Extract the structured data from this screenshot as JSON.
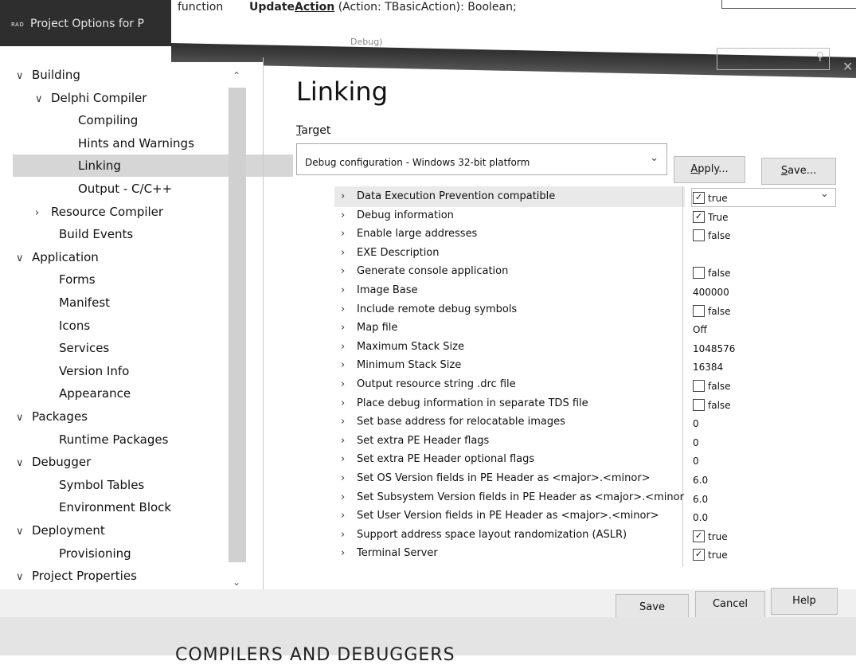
{
  "background_code": {
    "keyword": "function",
    "signature_prefix": "Update",
    "signature_underlined": "Action",
    "signature_rest": " (Action: TBasicAction): Boolean;",
    "fragment": "Debug)"
  },
  "window": {
    "app_icon_text": "RAD",
    "title": "Project Options for P"
  },
  "tree": {
    "items": [
      {
        "label": "Building",
        "expander": "v"
      },
      {
        "label": "Delphi Compiler",
        "expander": "v"
      },
      {
        "label": "Compiling",
        "expander": ""
      },
      {
        "label": "Hints and Warnings",
        "expander": ""
      },
      {
        "label": "Linking",
        "expander": "",
        "selected": true
      },
      {
        "label": "Output - C/C++",
        "expander": ""
      },
      {
        "label": "Resource Compiler",
        "expander": ">"
      },
      {
        "label": "Build Events",
        "expander": ""
      },
      {
        "label": "Application",
        "expander": "v"
      },
      {
        "label": "Forms",
        "expander": ""
      },
      {
        "label": "Manifest",
        "expander": ""
      },
      {
        "label": "Icons",
        "expander": ""
      },
      {
        "label": "Services",
        "expander": ""
      },
      {
        "label": "Version Info",
        "expander": ""
      },
      {
        "label": "Appearance",
        "expander": ""
      },
      {
        "label": "Packages",
        "expander": "v"
      },
      {
        "label": "Runtime Packages",
        "expander": ""
      },
      {
        "label": "Debugger",
        "expander": "v"
      },
      {
        "label": "Symbol Tables",
        "expander": ""
      },
      {
        "label": "Environment Block",
        "expander": ""
      },
      {
        "label": "Deployment",
        "expander": "v"
      },
      {
        "label": "Provisioning",
        "expander": ""
      },
      {
        "label": "Project Properties",
        "expander": "v"
      }
    ]
  },
  "main": {
    "title": "Linking",
    "target_label_underlined": "T",
    "target_label_rest": "arget",
    "target_value": "Debug configuration - Windows 32-bit platform",
    "apply_underlined": "A",
    "apply_rest": "pply...",
    "save_underlined": "S",
    "save_rest": "ave..."
  },
  "properties": [
    {
      "name": "Data Execution Prevention compatible",
      "value": "true",
      "checkbox": true,
      "checked": true
    },
    {
      "name": "Debug information",
      "value": "True",
      "checkbox": true,
      "checked": true
    },
    {
      "name": "Enable large addresses",
      "value": "false",
      "checkbox": true,
      "checked": false
    },
    {
      "name": "EXE Description",
      "value": "",
      "checkbox": false
    },
    {
      "name": "Generate console application",
      "value": "false",
      "checkbox": true,
      "checked": false
    },
    {
      "name": "Image Base",
      "value": "400000",
      "checkbox": false
    },
    {
      "name": "Include remote debug symbols",
      "value": "false",
      "checkbox": true,
      "checked": false
    },
    {
      "name": "Map file",
      "value": "Off",
      "checkbox": false
    },
    {
      "name": "Maximum Stack Size",
      "value": "1048576",
      "checkbox": false
    },
    {
      "name": "Minimum Stack Size",
      "value": "16384",
      "checkbox": false
    },
    {
      "name": "Output resource string .drc file",
      "value": "false",
      "checkbox": true,
      "checked": false
    },
    {
      "name": "Place debug information in separate TDS file",
      "value": "false",
      "checkbox": true,
      "checked": false
    },
    {
      "name": "Set base address for relocatable images",
      "value": "0",
      "checkbox": false
    },
    {
      "name": "Set extra PE Header flags",
      "value": "0",
      "checkbox": false
    },
    {
      "name": "Set extra PE Header optional flags",
      "value": "0",
      "checkbox": false
    },
    {
      "name": "Set OS Version fields in PE Header as <major>.<minor>",
      "value": "6.0",
      "checkbox": false
    },
    {
      "name": "Set Subsystem Version fields in PE Header as <major>.<minor",
      "value": "6.0",
      "checkbox": false
    },
    {
      "name": "Set User Version fields in PE Header as <major>.<minor>",
      "value": "0.0",
      "checkbox": false
    },
    {
      "name": "Support address space layout randomization (ASLR)",
      "value": "true",
      "checkbox": true,
      "checked": true
    },
    {
      "name": "Terminal Server",
      "value": "true",
      "checkbox": true,
      "checked": true
    }
  ],
  "footer": {
    "save": "Save",
    "cancel": "Cancel",
    "help": "Help"
  },
  "underlying_text": "COMPILERS AND DEBUGGERS"
}
